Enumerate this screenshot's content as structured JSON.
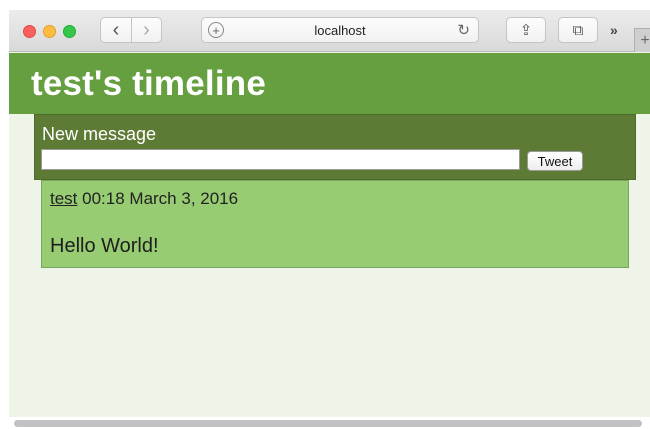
{
  "browser": {
    "url": "localhost",
    "icons": {
      "back": "chevron-left-icon",
      "forward": "chevron-right-icon",
      "site": "plus-circle-icon",
      "reload": "reload-icon",
      "share": "share-icon",
      "tabs": "tabs-overview-icon",
      "more": "double-chevron-icon",
      "new_tab": "plus-icon"
    },
    "glyphs": {
      "back": "‹",
      "forward": "›",
      "site": "+",
      "reload": "↻",
      "share": "⇪",
      "tabs": "⧉",
      "more": "»",
      "new_tab": "+"
    }
  },
  "page": {
    "title": "test's timeline",
    "compose": {
      "label": "New message",
      "input_value": "",
      "button_label": "Tweet"
    },
    "tweets": [
      {
        "user": "test",
        "timestamp": "00:18 March 3, 2016",
        "text": "Hello World!"
      }
    ]
  },
  "colors": {
    "header": "#659f3f",
    "compose_bg": "#5e7b36",
    "tweet_bg": "#97cc72",
    "page_bg": "#eef4e7"
  }
}
